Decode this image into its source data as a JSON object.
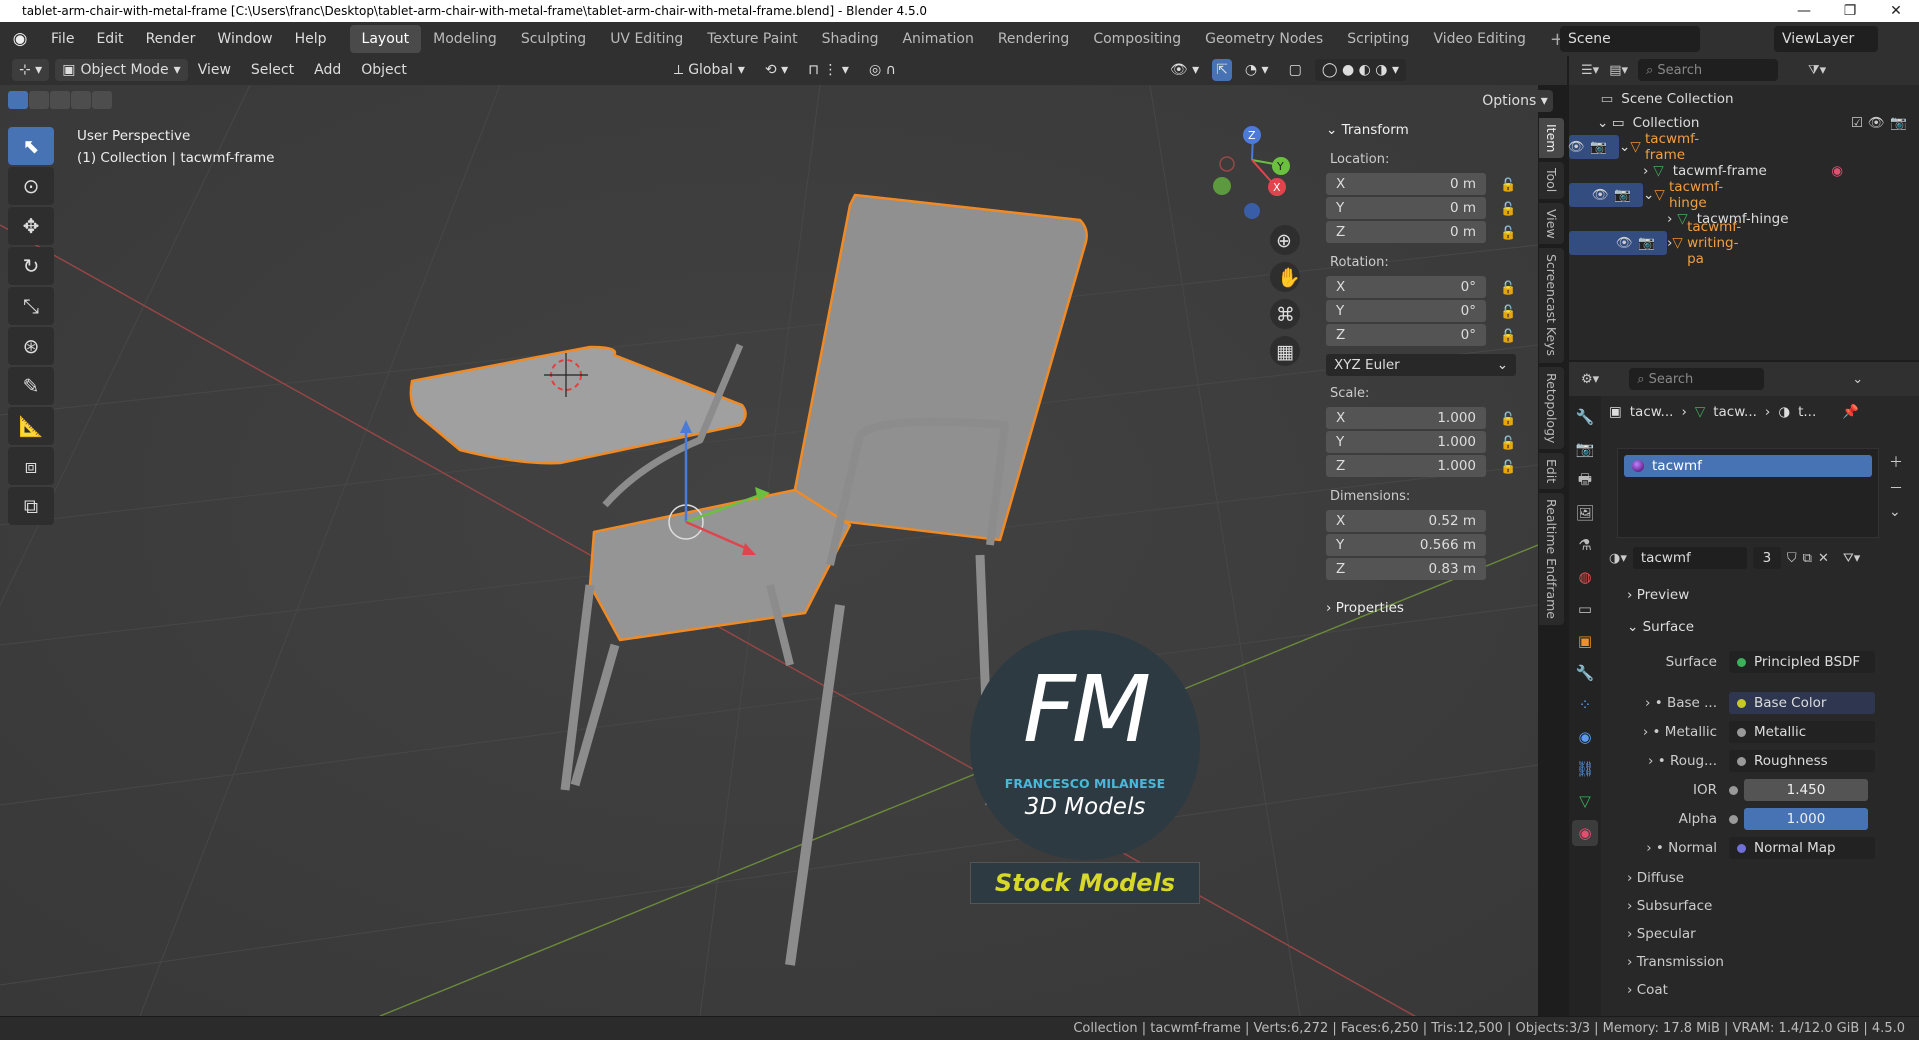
{
  "window": {
    "title": "tablet-arm-chair-with-metal-frame [C:\\Users\\franc\\Desktop\\tablet-arm-chair-with-metal-frame\\tablet-arm-chair-with-metal-frame.blend] - Blender 4.5.0",
    "min": "—",
    "max": "❐",
    "close": "✕"
  },
  "menu": [
    "File",
    "Edit",
    "Render",
    "Window",
    "Help"
  ],
  "workspaces": [
    "Layout",
    "Modeling",
    "Sculpting",
    "UV Editing",
    "Texture Paint",
    "Shading",
    "Animation",
    "Rendering",
    "Compositing",
    "Geometry Nodes",
    "Scripting",
    "Video Editing"
  ],
  "active_workspace": "Layout",
  "scene": "Scene",
  "view_layer": "ViewLayer",
  "viewport_header": {
    "mode": "Object Mode",
    "menus": [
      "View",
      "Select",
      "Add",
      "Object"
    ],
    "orientation": "Global",
    "options": "Options"
  },
  "overlay": {
    "perspective": "User Perspective",
    "collection": "(1) Collection | tacwmf-frame"
  },
  "gizmo": {
    "x": "X",
    "y": "Y",
    "z": "Z"
  },
  "npanel": {
    "header": "Transform",
    "location_label": "Location:",
    "location": [
      {
        "axis": "X",
        "value": "0 m"
      },
      {
        "axis": "Y",
        "value": "0 m"
      },
      {
        "axis": "Z",
        "value": "0 m"
      }
    ],
    "rotation_label": "Rotation:",
    "rotation": [
      {
        "axis": "X",
        "value": "0°"
      },
      {
        "axis": "Y",
        "value": "0°"
      },
      {
        "axis": "Z",
        "value": "0°"
      }
    ],
    "rotation_mode": "XYZ Euler",
    "scale_label": "Scale:",
    "scale": [
      {
        "axis": "X",
        "value": "1.000"
      },
      {
        "axis": "Y",
        "value": "1.000"
      },
      {
        "axis": "Z",
        "value": "1.000"
      }
    ],
    "dimensions_label": "Dimensions:",
    "dimensions": [
      {
        "axis": "X",
        "value": "0.52 m"
      },
      {
        "axis": "Y",
        "value": "0.566 m"
      },
      {
        "axis": "Z",
        "value": "0.83 m"
      }
    ],
    "properties": "Properties"
  },
  "side_tabs": [
    "Item",
    "Tool",
    "View",
    "Screencast Keys",
    "Retopology",
    "Edit",
    "Realtime Endframe"
  ],
  "outliner": {
    "search_placeholder": "Search",
    "rows": [
      {
        "name": "Scene Collection"
      },
      {
        "name": "Collection"
      },
      {
        "name": "tacwmf-frame"
      },
      {
        "name": "tacwmf-frame"
      },
      {
        "name": "tacwmf-hinge"
      },
      {
        "name": "tacwmf-hinge"
      },
      {
        "name": "tacwmf-writing-pa"
      }
    ]
  },
  "properties": {
    "search_placeholder": "Search",
    "breadcrumb": [
      "tacw...",
      "tacw...",
      "t..."
    ],
    "material_slot": "tacwmf",
    "material_name": "tacwmf",
    "users": "3",
    "preview": "Preview",
    "surface_header": "Surface",
    "surface_label": "Surface",
    "surface_value": "Principled BSDF",
    "inputs": [
      {
        "label": "Base ...",
        "value": "Base Color"
      },
      {
        "label": "Metallic",
        "value": "Metallic"
      },
      {
        "label": "Roug...",
        "value": "Roughness"
      }
    ],
    "ior_label": "IOR",
    "ior_value": "1.450",
    "alpha_label": "Alpha",
    "alpha_value": "1.000",
    "normal_label": "Normal",
    "normal_value": "Normal Map",
    "subpanels": [
      "Diffuse",
      "Subsurface",
      "Specular",
      "Transmission",
      "Coat"
    ]
  },
  "watermark": {
    "logo": "FM",
    "name": "FRANCESCO MILANESE",
    "sub": "3D Models",
    "banner": "Stock Models"
  },
  "status": "Collection | tacwmf-frame | Verts:6,272 | Faces:6,250 | Tris:12,500 | Objects:3/3 | Memory: 17.8 MiB | VRAM: 1.4/12.0 GiB | 4.5.0"
}
